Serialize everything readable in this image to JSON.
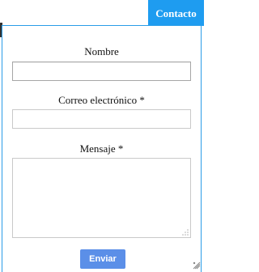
{
  "header": {
    "contact_tab_label": "Contacto",
    "accent_color": "#1e9cf0"
  },
  "form": {
    "name_label": "Nombre",
    "name_value": "",
    "email_label": "Correo electrónico *",
    "email_value": "",
    "message_label": "Mensaje *",
    "message_value": "",
    "submit_label": "Enviar",
    "submit_color": "#5b8fe8"
  }
}
